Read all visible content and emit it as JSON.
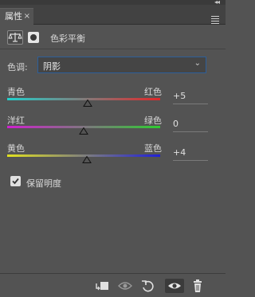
{
  "panel": {
    "tab_label": "属性",
    "collapse_glyph": "◂◂",
    "tab_close": "×"
  },
  "adjustment": {
    "title": "色彩平衡"
  },
  "tone": {
    "label": "色调:",
    "value": "阴影"
  },
  "sliders": [
    {
      "left_label": "青色",
      "right_label": "红色",
      "value_text": "+5",
      "value": 5,
      "min": -100,
      "max": 100,
      "from_color": "#22d0cc",
      "to_color": "#e0282a"
    },
    {
      "left_label": "洋红",
      "right_label": "绿色",
      "value_text": "0",
      "value": 0,
      "min": -100,
      "max": 100,
      "from_color": "#d020d0",
      "to_color": "#2ecc30"
    },
    {
      "left_label": "黄色",
      "right_label": "蓝色",
      "value_text": "+4",
      "value": 4,
      "min": -100,
      "max": 100,
      "from_color": "#e0e020",
      "to_color": "#2020d8"
    }
  ],
  "preserve": {
    "label": "保留明度",
    "checked": true
  },
  "colors": {
    "select_border": "#2d5f9a",
    "panel_bg": "#535353"
  }
}
